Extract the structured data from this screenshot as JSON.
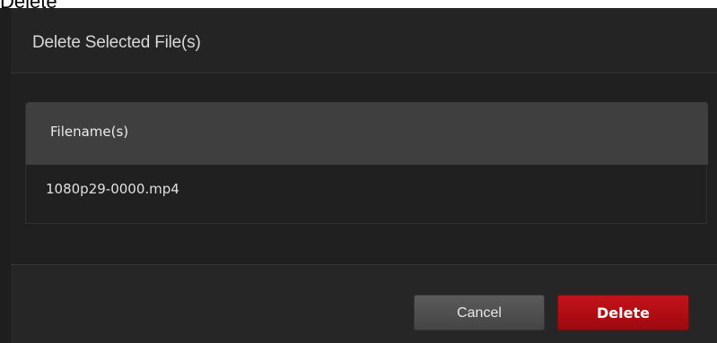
{
  "backdrop": {
    "title": "Delete"
  },
  "dialog": {
    "title": "Delete Selected File(s)",
    "table": {
      "column_header": "Filename(s)",
      "rows": [
        "1080p29-0000.mp4"
      ]
    },
    "buttons": {
      "cancel_label": "Cancel",
      "delete_label": "Delete"
    }
  },
  "colors": {
    "dialog_background": "#222222",
    "table_header": "#3f3f3f",
    "cancel_button": "#505050",
    "delete_button": "#b50f16"
  }
}
